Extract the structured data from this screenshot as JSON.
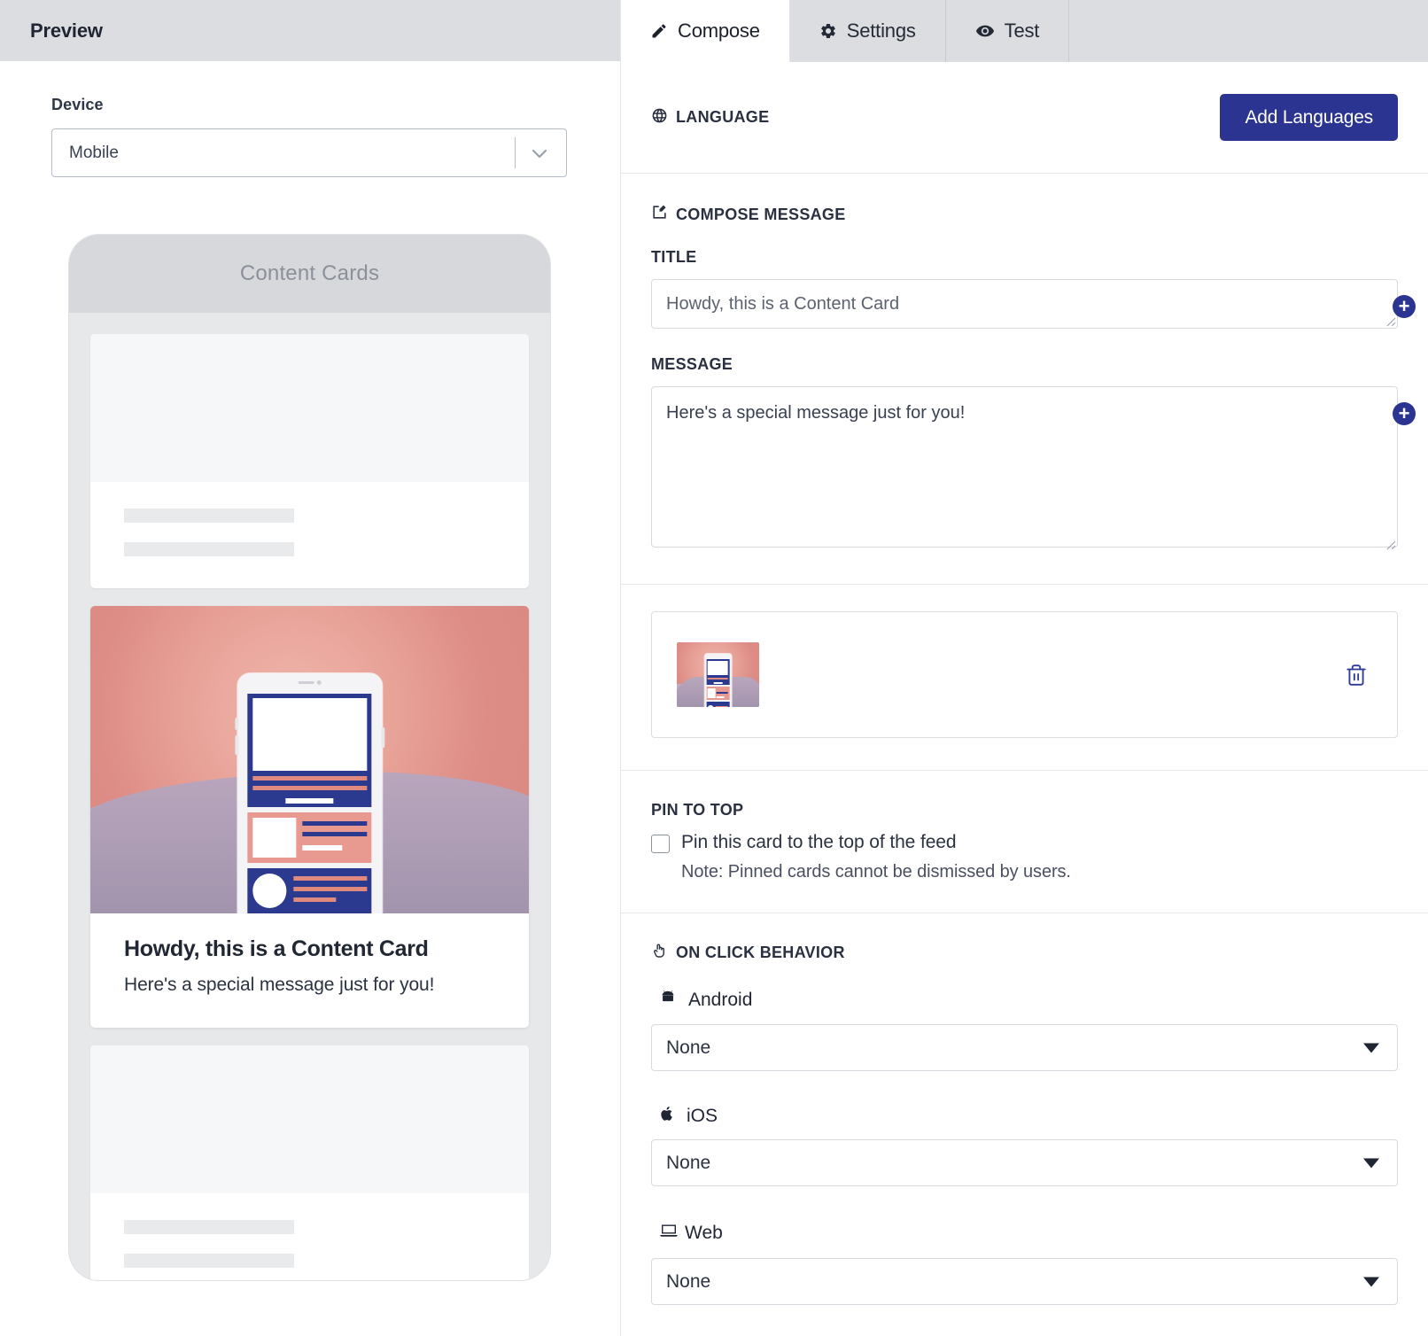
{
  "preview": {
    "header_title": "Preview",
    "device_label": "Device",
    "device_value": "Mobile",
    "phone_header": "Content Cards",
    "card": {
      "title": "Howdy, this is a Content Card",
      "message": "Here's a special message just for you!"
    }
  },
  "tabs": [
    {
      "label": "Compose",
      "icon": "pencil-icon",
      "active": true
    },
    {
      "label": "Settings",
      "icon": "gear-icon",
      "active": false
    },
    {
      "label": "Test",
      "icon": "eye-icon",
      "active": false
    }
  ],
  "language": {
    "heading": "LANGUAGE",
    "icon": "globe-icon",
    "add_button": "Add Languages"
  },
  "compose": {
    "heading": "COMPOSE MESSAGE",
    "icon": "pencil-square-icon",
    "title_label": "TITLE",
    "title_value": "Howdy, this is a Content Card",
    "title_placeholder": "Howdy, this is a Content Card",
    "message_label": "MESSAGE",
    "message_value": "Here's a special message just for you!",
    "message_placeholder": "Here's a special message just for you!",
    "add_badge": "+"
  },
  "media": {
    "delete_icon": "trash-icon"
  },
  "pin": {
    "heading": "PIN TO TOP",
    "checkbox_label": "Pin this card to the top of the feed",
    "note": "Note: Pinned cards cannot be dismissed by users.",
    "checked": false
  },
  "on_click": {
    "heading": "ON CLICK BEHAVIOR",
    "icon": "pointer-hand-icon",
    "platforms": [
      {
        "name": "Android",
        "icon": "android-icon",
        "value": "None"
      },
      {
        "name": "iOS",
        "icon": "apple-icon",
        "value": "None"
      },
      {
        "name": "Web",
        "icon": "laptop-icon",
        "value": "None"
      }
    ]
  },
  "colors": {
    "primary": "#2b3490",
    "header_bg": "#dcdde1",
    "illustration_navy": "#2b3a8f",
    "illustration_salmon": "#e89a90"
  }
}
